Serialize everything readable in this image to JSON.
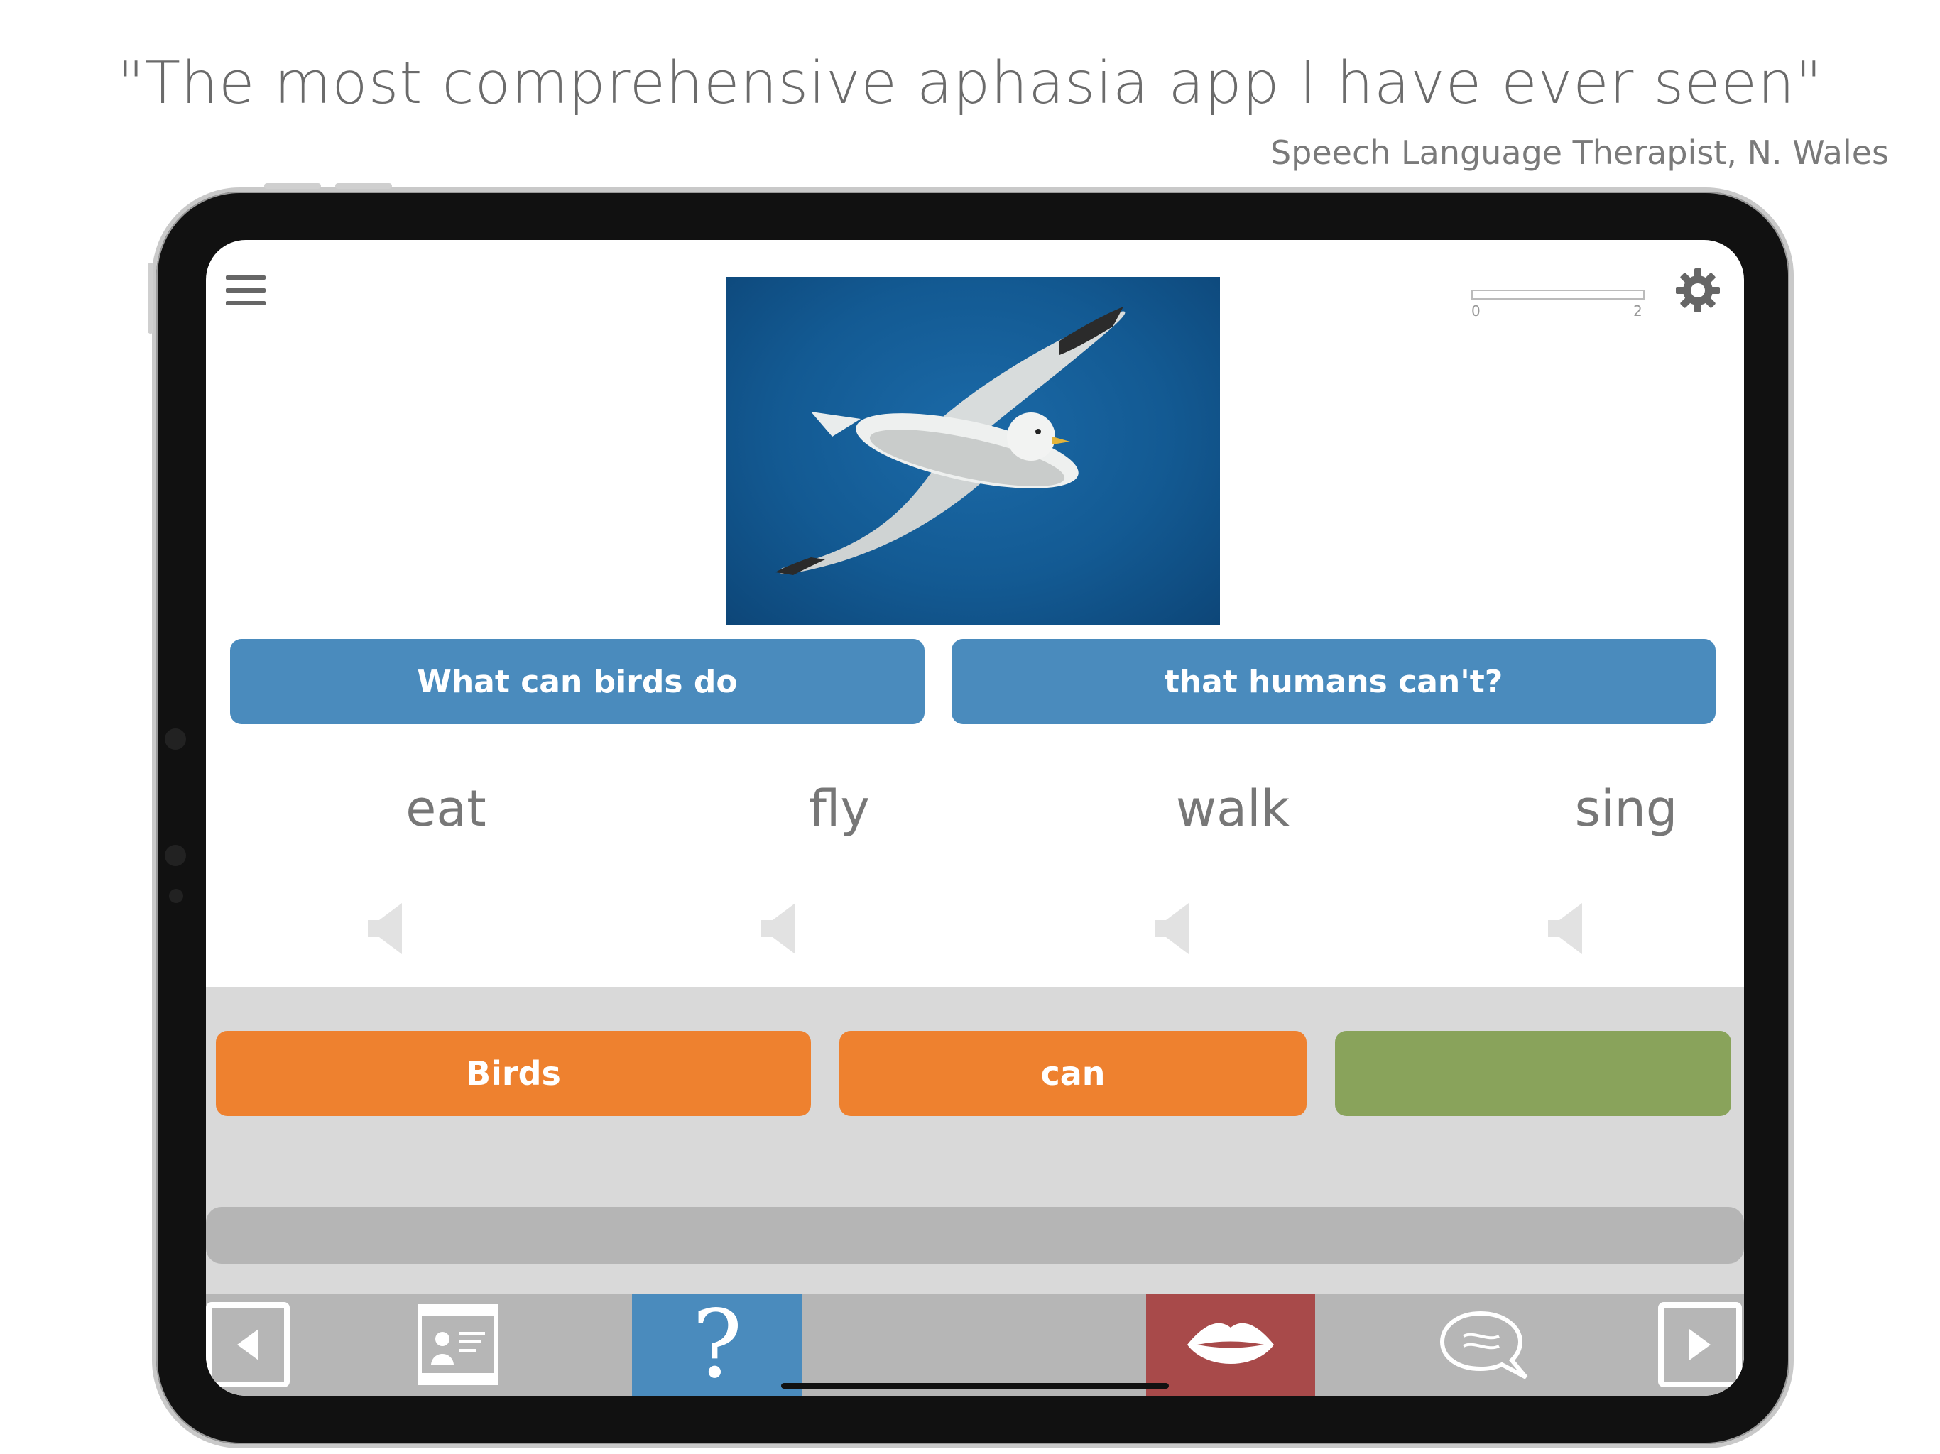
{
  "promo": {
    "headline": "\"The most comprehensive aphasia app I have ever seen\"",
    "attribution": "Speech Language Therapist, N. Wales"
  },
  "progress": {
    "min_label": "0",
    "max_label": "2",
    "value_fraction": 0.0
  },
  "prompt": {
    "part1": "What can birds do",
    "part2": "that humans can't?"
  },
  "choices": [
    {
      "label": "eat"
    },
    {
      "label": "fly"
    },
    {
      "label": "walk"
    },
    {
      "label": "sing"
    }
  ],
  "answer": {
    "chips": [
      {
        "label": "Birds",
        "color": "#ee812f"
      },
      {
        "label": "can",
        "color": "#ee812f"
      },
      {
        "label": "",
        "color": "#89a35b"
      }
    ]
  },
  "colors": {
    "prompt_blue": "#4a8bbd",
    "help_button": "#4a8bbd",
    "speak_button": "#a84a4a",
    "toolbar": "#b6b6b6",
    "answer_area": "#d9d9d9"
  },
  "icons": {
    "menu": "menu-icon",
    "settings": "gear-icon",
    "speaker": "speaker-icon",
    "prev": "arrow-left-icon",
    "next": "arrow-right-icon",
    "cue": "picture-cue-icon",
    "help": "question-mark",
    "speak": "lips-icon",
    "chat": "speech-bubble-icon"
  },
  "toolbar": {
    "help_label": "?"
  }
}
